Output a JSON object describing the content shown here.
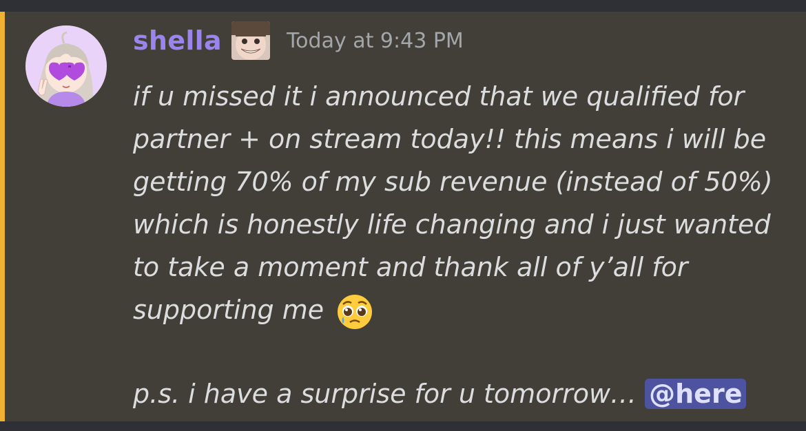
{
  "message": {
    "author": "shella",
    "timestamp": "Today at 9:43 PM",
    "text_main": "if u missed it i announced that we qualified for partner + on stream today!! this means i will be getting 70% of my sub revenue (instead of 50%) which is honestly life changing and i just wanted to take a moment and thank all of y’all for supporting me",
    "emoji": "pleading-face-with-tear",
    "text_ps": "p.s. i have a surprise for u tomorrow…",
    "mention": "@here",
    "accent_color": "#f0b132",
    "username_color": "#9b84ec"
  }
}
